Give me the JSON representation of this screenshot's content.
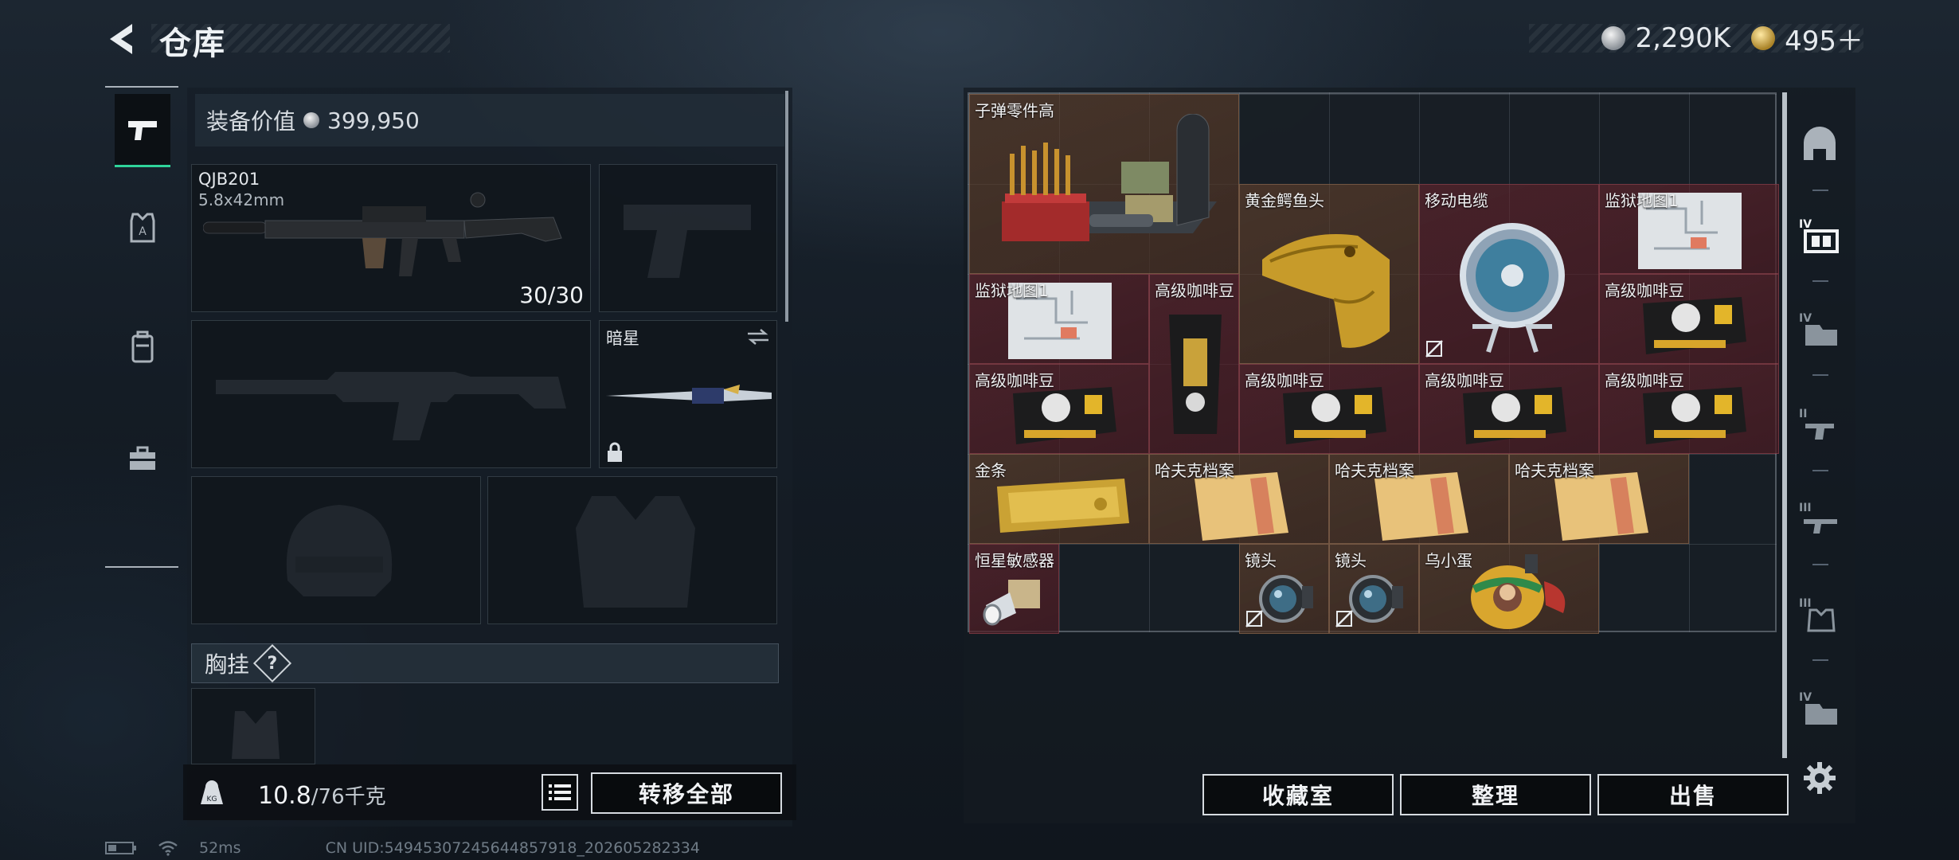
{
  "header": {
    "title": "仓库"
  },
  "currency": {
    "silver_amount": "2,290K",
    "gold_amount": "495＋"
  },
  "equipment": {
    "value_label": "装备价值",
    "value_amount": "399,950",
    "primary_weapon": {
      "name": "QJB201",
      "caliber": "5.8x42mm",
      "ammo": "30/30"
    },
    "melee": {
      "name": "暗星"
    },
    "chest_rig_label": "胸挂",
    "chest_rig_help": "?"
  },
  "weight": {
    "current": "10.8",
    "max": "/76千克"
  },
  "buttons": {
    "transfer_all": "转移全部",
    "collection": "收藏室",
    "organize": "整理",
    "sell": "出售"
  },
  "stash_items": [
    {
      "id": "ammo-parts",
      "label": "子弹零件高"
    },
    {
      "id": "gold-croc",
      "label": "黄金鳄鱼头"
    },
    {
      "id": "cable-reel",
      "label": "移动电缆"
    },
    {
      "id": "prison-map-1",
      "label": "监狱地图1"
    },
    {
      "id": "prison-map-2",
      "label": "监狱地图1"
    },
    {
      "id": "coffee-1",
      "label": "高级咖啡豆"
    },
    {
      "id": "coffee-2",
      "label": "高级咖啡豆"
    },
    {
      "id": "coffee-3",
      "label": "高级咖啡豆"
    },
    {
      "id": "coffee-4",
      "label": "高级咖啡豆"
    },
    {
      "id": "coffee-5",
      "label": "高级咖啡豆"
    },
    {
      "id": "coffee-6",
      "label": "高级咖啡豆"
    },
    {
      "id": "gold-bar",
      "label": "金条"
    },
    {
      "id": "hafk-1",
      "label": "哈夫克档案"
    },
    {
      "id": "hafk-2",
      "label": "哈夫克档案"
    },
    {
      "id": "hafk-3",
      "label": "哈夫克档案"
    },
    {
      "id": "star-sensor",
      "label": "恒星敏感器"
    },
    {
      "id": "lens-1",
      "label": "镜头"
    },
    {
      "id": "lens-2",
      "label": "镜头"
    },
    {
      "id": "crow-egg",
      "label": "乌小蛋"
    }
  ],
  "right_nav": [
    "helmet-tab-icon",
    "stash-tab-4-icon",
    "stash-tab-4b-icon",
    "stash-tab-2-icon",
    "stash-tab-3-icon",
    "stash-tab-3b-icon",
    "stash-tab-4c-icon",
    "settings-icon"
  ],
  "status": {
    "ping": "52ms",
    "uid": "CN UID:5494530724564485791​8_202605282334"
  },
  "colors": {
    "accent": "#2fd39a",
    "rare_gold_bg": "#6c462e",
    "rare_red_bg": "#6e262e"
  }
}
